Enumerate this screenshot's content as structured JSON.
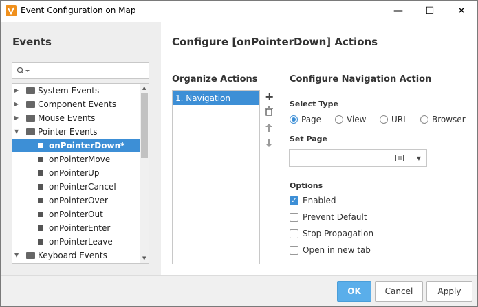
{
  "window": {
    "title": "Event Configuration on Map",
    "minimize_glyph": "—",
    "maximize_glyph": "☐",
    "close_glyph": "✕"
  },
  "events_panel": {
    "title": "Events",
    "search_placeholder": "",
    "tree": [
      {
        "label": "System Events",
        "kind": "folder",
        "expanded": false
      },
      {
        "label": "Component Events",
        "kind": "folder",
        "expanded": false
      },
      {
        "label": "Mouse Events",
        "kind": "folder",
        "expanded": false
      },
      {
        "label": "Pointer Events",
        "kind": "folder",
        "expanded": true
      },
      {
        "label": "onPointerDown*",
        "kind": "leaf",
        "selected": true
      },
      {
        "label": "onPointerMove",
        "kind": "leaf"
      },
      {
        "label": "onPointerUp",
        "kind": "leaf"
      },
      {
        "label": "onPointerCancel",
        "kind": "leaf"
      },
      {
        "label": "onPointerOver",
        "kind": "leaf"
      },
      {
        "label": "onPointerOut",
        "kind": "leaf"
      },
      {
        "label": "onPointerEnter",
        "kind": "leaf"
      },
      {
        "label": "onPointerLeave",
        "kind": "leaf"
      },
      {
        "label": "Keyboard Events",
        "kind": "folder",
        "expanded": true
      }
    ]
  },
  "configure": {
    "title": "Configure [onPointerDown] Actions",
    "organize_title": "Organize Actions",
    "actions": [
      "1. Navigation"
    ],
    "nav_title": "Configure Navigation Action",
    "select_type_label": "Select Type",
    "types": [
      "Page",
      "View",
      "URL",
      "Browser"
    ],
    "selected_type": "Page",
    "set_page_label": "Set Page",
    "set_page_value": "",
    "options_label": "Options",
    "options": [
      {
        "label": "Enabled",
        "checked": true
      },
      {
        "label": "Prevent Default",
        "checked": false
      },
      {
        "label": "Stop Propagation",
        "checked": false
      },
      {
        "label": "Open in new tab",
        "checked": false
      }
    ]
  },
  "footer": {
    "ok": "OK",
    "cancel": "Cancel",
    "apply": "Apply"
  },
  "colors": {
    "accent": "#3d8fd6",
    "primary_button": "#5aaeea",
    "panel_bg": "#eeeeee"
  }
}
